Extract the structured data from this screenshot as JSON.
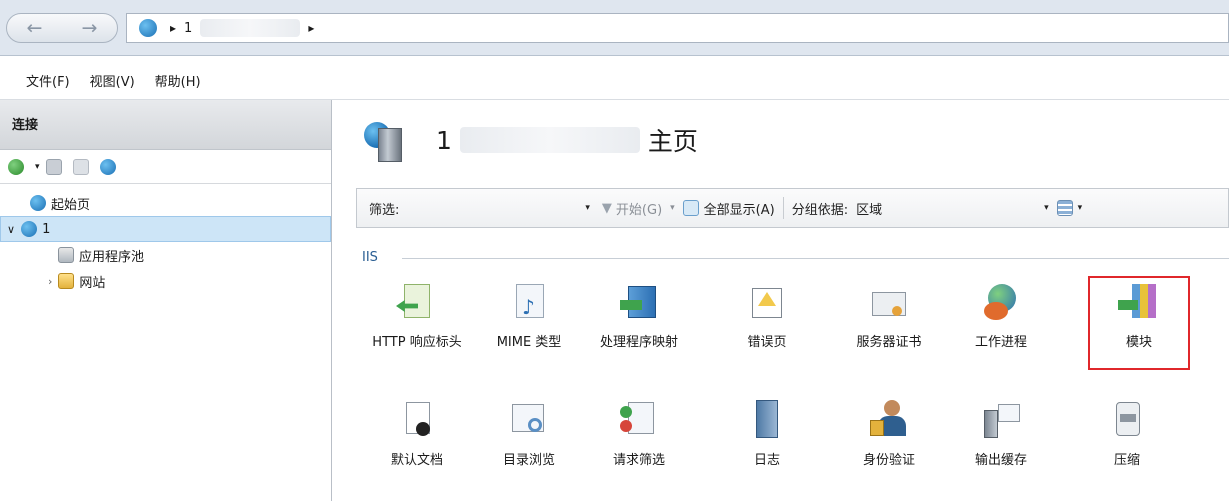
{
  "address": {
    "segment1": "1",
    "arrow": "▸"
  },
  "menu": {
    "file": "文件(F)",
    "view": "视图(V)",
    "help": "帮助(H)"
  },
  "connections": {
    "title": "连接",
    "tree": [
      {
        "label": "起始页"
      },
      {
        "label": "1"
      },
      {
        "label": "应用程序池"
      },
      {
        "label": "网站"
      }
    ]
  },
  "main": {
    "title_prefix": "1",
    "title_suffix": "主页",
    "filter": {
      "label": "筛选:",
      "go": "开始(G)",
      "showall": "全部显示(A)",
      "groupby": "分组依据:",
      "groupvalue": "区域"
    },
    "group": "IIS",
    "features_row1": [
      {
        "label": "HTTP 响应标头"
      },
      {
        "label": "MIME 类型"
      },
      {
        "label": "处理程序映射"
      },
      {
        "label": "错误页"
      },
      {
        "label": "服务器证书"
      },
      {
        "label": "工作进程"
      },
      {
        "label": "模块"
      }
    ],
    "features_row2": [
      {
        "label": "默认文档"
      },
      {
        "label": "目录浏览"
      },
      {
        "label": "请求筛选"
      },
      {
        "label": "日志"
      },
      {
        "label": "身份验证"
      },
      {
        "label": "输出缓存"
      },
      {
        "label": "压缩"
      }
    ]
  },
  "colors": {
    "highlight": "#e0272b",
    "selected": "#cde5f7",
    "group": "#2a5e93"
  }
}
